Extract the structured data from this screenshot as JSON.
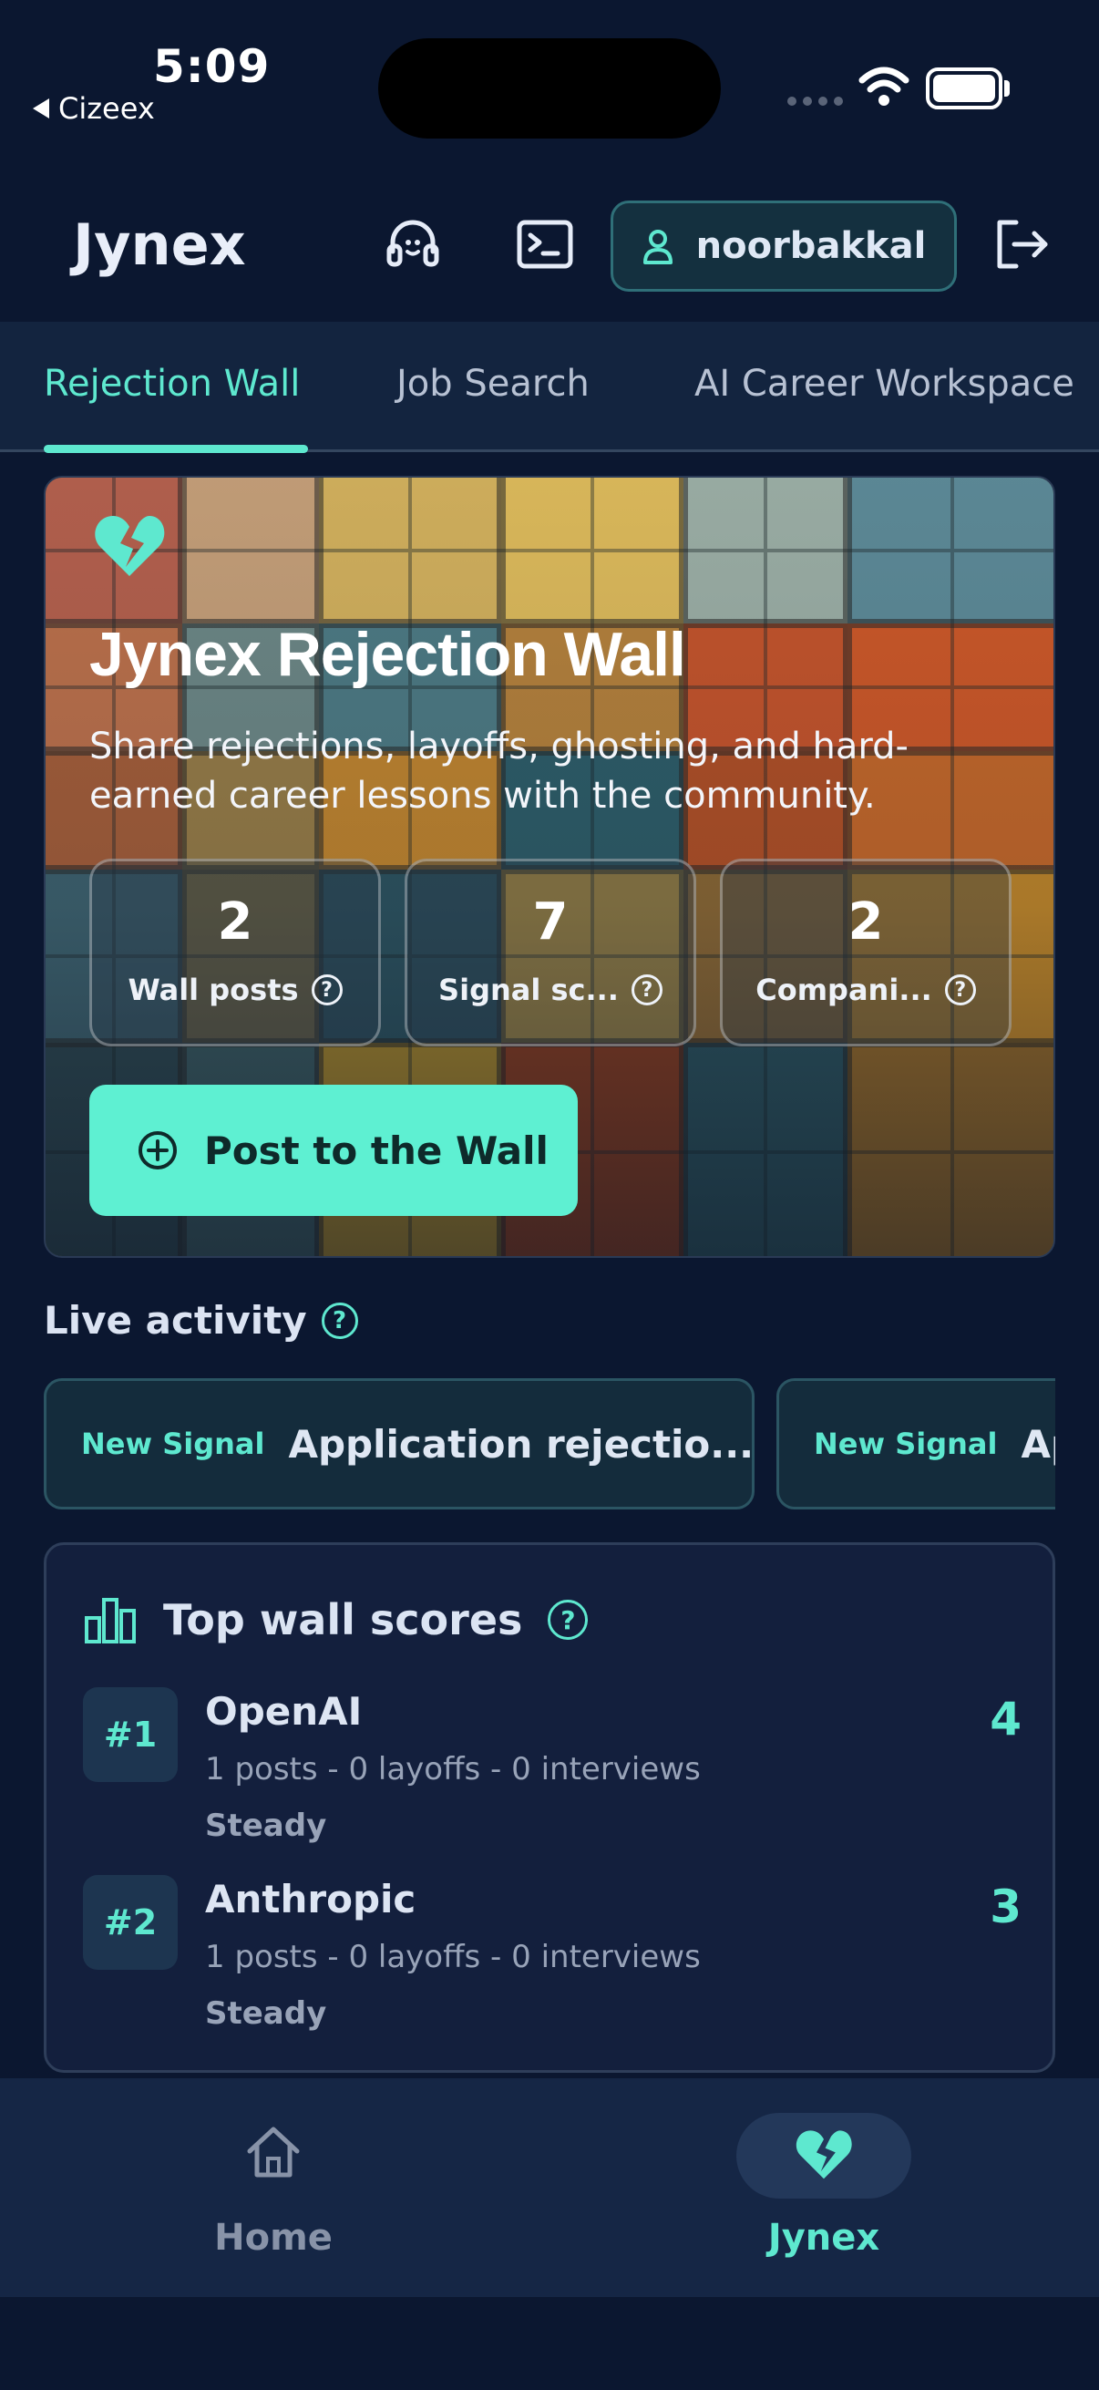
{
  "status_bar": {
    "time": "5:09",
    "back_app": "Cizeex"
  },
  "header": {
    "brand": "Jynex",
    "username": "noorbakkal",
    "icons": [
      "support-headset-icon",
      "terminal-icon",
      "user-icon",
      "logout-icon"
    ]
  },
  "tabs": [
    {
      "label": "Rejection Wall",
      "active": true
    },
    {
      "label": "Job Search",
      "active": false
    },
    {
      "label": "AI Career Workspace",
      "active": false
    }
  ],
  "hero": {
    "icon": "broken-heart-icon",
    "title": "Jynex Rejection Wall",
    "description": "Share rejections, layoffs, ghosting, and hard-earned career lessons with the community.",
    "stats": [
      {
        "value": "2",
        "label": "Wall posts"
      },
      {
        "value": "7",
        "label": "Signal sc..."
      },
      {
        "value": "2",
        "label": "Compani..."
      }
    ],
    "cta": "Post to the Wall"
  },
  "live_activity": {
    "title": "Live activity",
    "items": [
      {
        "tag": "New Signal",
        "text": "Application rejectio..."
      },
      {
        "tag": "New Signal",
        "text": "Ap"
      }
    ]
  },
  "top_scores": {
    "title": "Top wall scores",
    "rows": [
      {
        "rank": "#1",
        "company": "OpenAI",
        "meta": "1 posts - 0 layoffs - 0 interviews",
        "trend": "Steady",
        "score": "4"
      },
      {
        "rank": "#2",
        "company": "Anthropic",
        "meta": "1 posts - 0 layoffs - 0 interviews",
        "trend": "Steady",
        "score": "3"
      }
    ]
  },
  "bottom_nav": [
    {
      "label": "Home",
      "icon": "home-icon",
      "active": false
    },
    {
      "label": "Jynex",
      "icon": "broken-heart-icon",
      "active": true
    }
  ],
  "colors": {
    "background": "#0b1730",
    "accent": "#5ee8cf",
    "card": "#131f3d"
  }
}
